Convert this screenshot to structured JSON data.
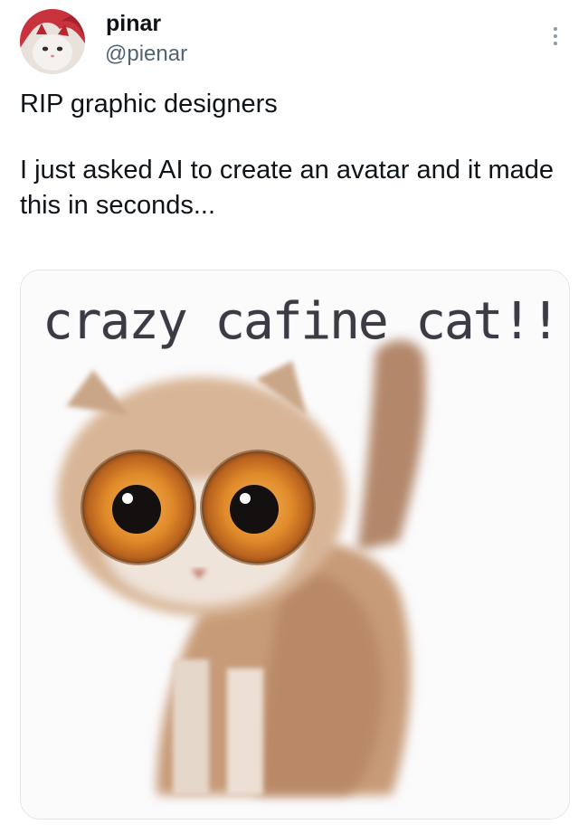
{
  "user": {
    "display_name": "pinar",
    "handle": "@pienar",
    "avatar": "avatar-cat-red-hair"
  },
  "tweet": {
    "line1": "RIP graphic designers",
    "line2": "I just asked AI to create an avatar and it made this in seconds...",
    "more_icon": "more-vertical-icon"
  },
  "media": {
    "caption": "crazy cafine cat!!!",
    "image_desc": "blurry kitten with huge orange eyes"
  },
  "colors": {
    "text": "#0f1419",
    "secondary": "#536471",
    "border": "#e3e6e9"
  }
}
